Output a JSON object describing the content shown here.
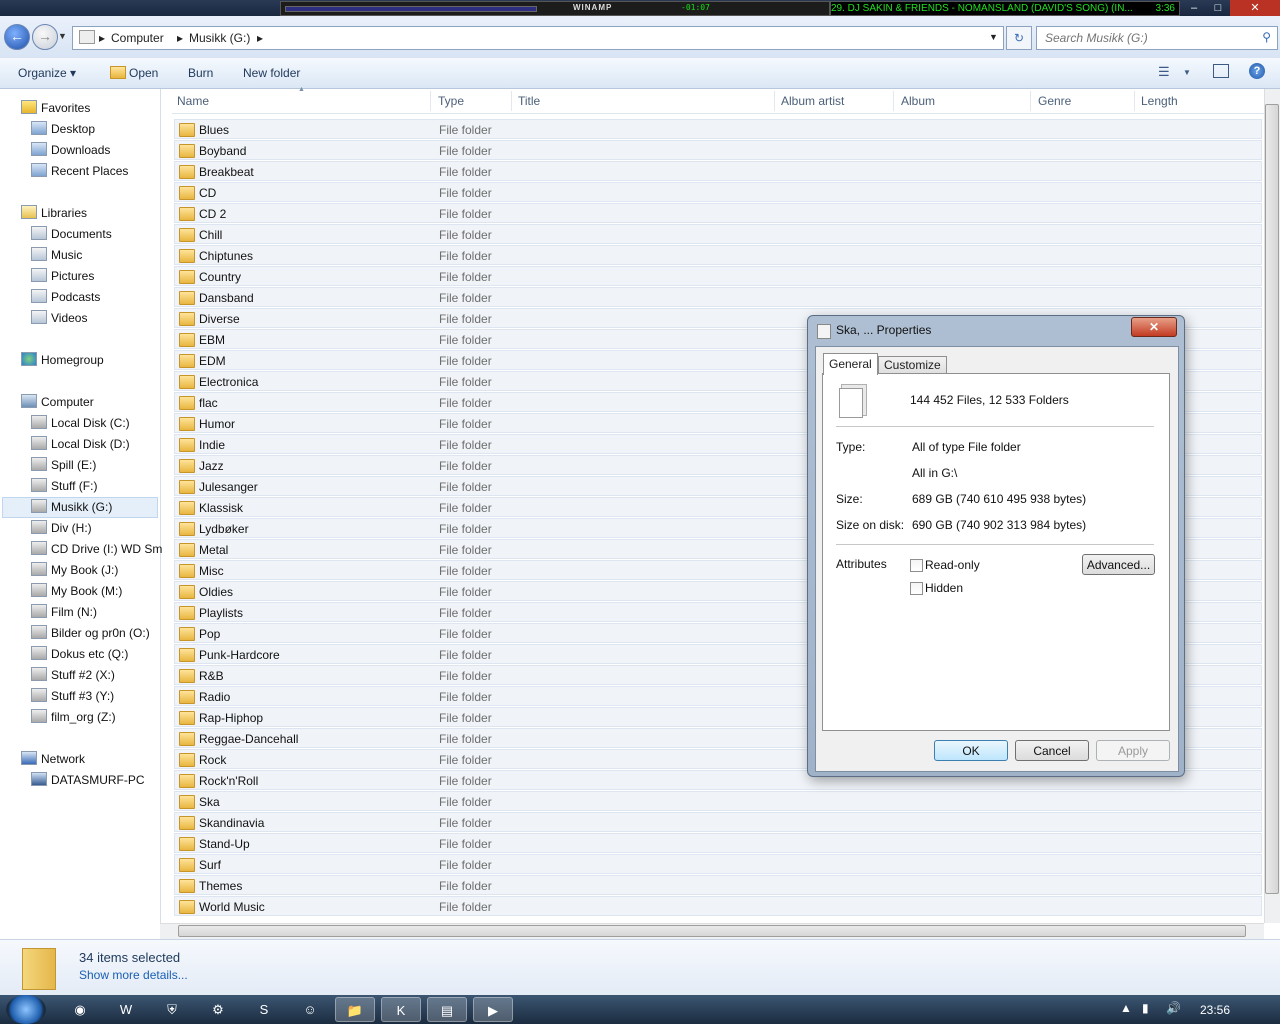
{
  "winamp": {
    "logo": "WINAMP",
    "time": "-01:07",
    "now_playing": "29. DJ SAKIN & FRIENDS - NOMANSLAND (DAVID'S SONG) (IN...",
    "track_time": "3:36"
  },
  "window_controls": {
    "minimize": "–",
    "maximize": "□",
    "close": "✕"
  },
  "address": {
    "crumbs": [
      "Computer",
      "Musikk (G:)"
    ],
    "search_placeholder": "Search Musikk (G:)"
  },
  "commands": {
    "organize": "Organize ▾",
    "open": "Open",
    "burn": "Burn",
    "new_folder": "New folder"
  },
  "nav": {
    "favorites": {
      "label": "Favorites",
      "items": [
        "Desktop",
        "Downloads",
        "Recent Places"
      ]
    },
    "libraries": {
      "label": "Libraries",
      "items": [
        "Documents",
        "Music",
        "Pictures",
        "Podcasts",
        "Videos"
      ]
    },
    "homegroup": "Homegroup",
    "computer": {
      "label": "Computer",
      "items": [
        "Local Disk (C:)",
        "Local Disk (D:)",
        "Spill (E:)",
        "Stuff (F:)",
        "Musikk (G:)",
        "Div (H:)",
        "CD Drive (I:) WD Sm",
        "My Book (J:)",
        "My Book (M:)",
        "Film (N:)",
        "Bilder og pr0n (O:)",
        "Dokus etc (Q:)",
        "Stuff #2 (X:)",
        "Stuff #3 (Y:)",
        "film_org (Z:)"
      ],
      "selected": "Musikk (G:)"
    },
    "network": {
      "label": "Network",
      "items": [
        "DATASMURF-PC"
      ]
    }
  },
  "columns": [
    "Name",
    "Type",
    "Title",
    "Album artist",
    "Album",
    "Genre",
    "Length"
  ],
  "folder_type": "File folder",
  "folders": [
    "Blues",
    "Boyband",
    "Breakbeat",
    "CD",
    "CD 2",
    "Chill",
    "Chiptunes",
    "Country",
    "Dansband",
    "Diverse",
    "EBM",
    "EDM",
    "Electronica",
    "flac",
    "Humor",
    "Indie",
    "Jazz",
    "Julesanger",
    "Klassisk",
    "Lydbøker",
    "Metal",
    "Misc",
    "Oldies",
    "Playlists",
    "Pop",
    "Punk-Hardcore",
    "R&B",
    "Radio",
    "Rap-Hiphop",
    "Reggae-Dancehall",
    "Rock",
    "Rock'n'Roll",
    "Ska",
    "Skandinavia",
    "Stand-Up",
    "Surf",
    "Themes",
    "World Music"
  ],
  "details": {
    "selected": "34 items selected",
    "more": "Show more details..."
  },
  "taskbar": {
    "clock": "23:56"
  },
  "dialog": {
    "title": "Ska, ... Properties",
    "close": "✕",
    "tabs": [
      "General",
      "Customize"
    ],
    "counts": "144 452 Files, 12 533 Folders",
    "type_label": "Type:",
    "type_value": "All of type File folder",
    "location_value": "All in G:\\",
    "size_label": "Size:",
    "size_value": "689 GB (740 610 495 938 bytes)",
    "disk_label": "Size on disk:",
    "disk_value": "690 GB (740 902 313 984 bytes)",
    "attributes_label": "Attributes",
    "readonly": "Read-only",
    "hidden": "Hidden",
    "advanced": "Advanced...",
    "ok": "OK",
    "cancel": "Cancel",
    "apply": "Apply"
  }
}
